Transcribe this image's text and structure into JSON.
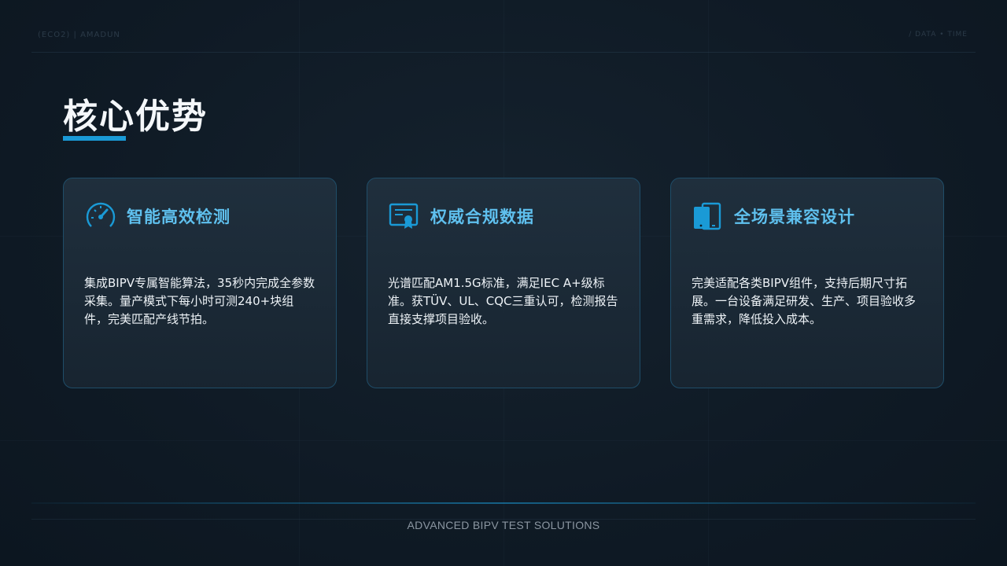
{
  "header": {
    "logo_text": "(ECO2) | AMADUN",
    "right_mark": "/ DATA • TIME"
  },
  "title": "核心优势",
  "cards": [
    {
      "icon": "speedometer-icon",
      "title": "智能高效检测",
      "body": "集成BIPV专属智能算法，35秒内完成全参数采集。量产模式下每小时可测240+块组件，完美匹配产线节拍。"
    },
    {
      "icon": "certificate-icon",
      "title": "权威合规数据",
      "body": "光谱匹配AM1.5G标准，满足IEC A+级标准。获TÜV、UL、CQC三重认可，检测报告直接支撑项目验收。"
    },
    {
      "icon": "devices-icon",
      "title": "全场景兼容设计",
      "body": "完美适配各类BIPV组件，支持后期尺寸拓展。一台设备满足研发、生产、项目验收多重需求，降低投入成本。"
    }
  ],
  "footer": {
    "center": "ADVANCED BIPV TEST SOLUTIONS",
    "left": "",
    "right": ""
  },
  "colors": {
    "accent": "#1a9ad6",
    "card_title": "#5fc0ee",
    "background": "#0f1a25"
  }
}
